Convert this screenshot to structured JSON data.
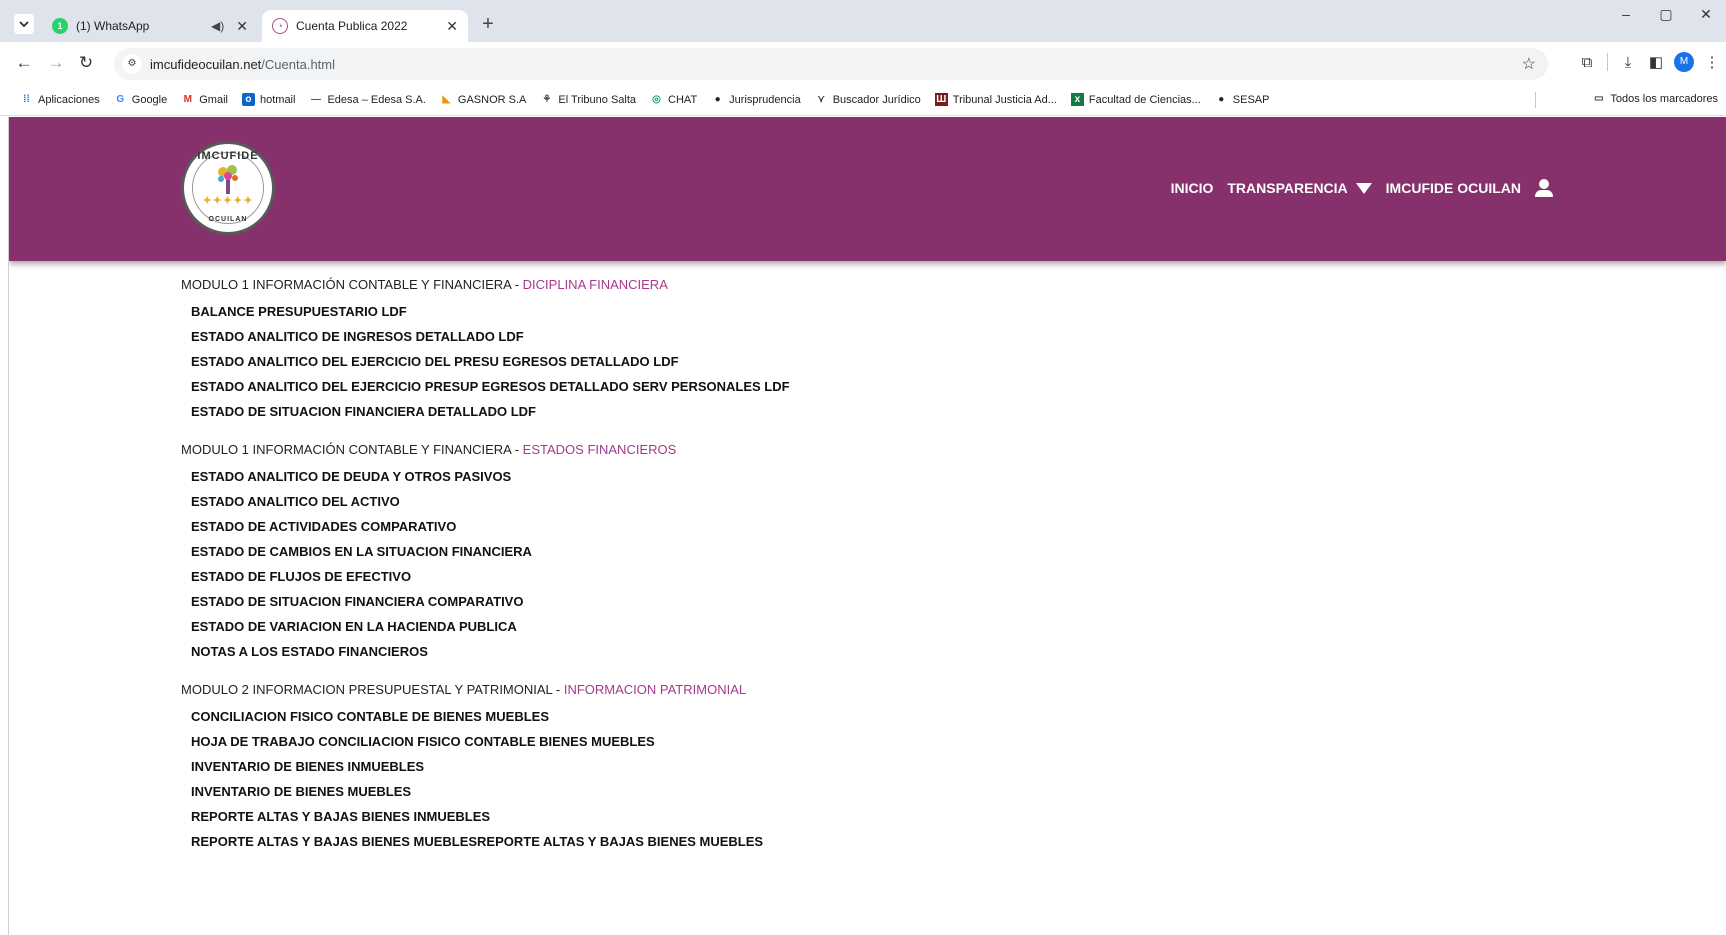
{
  "browser": {
    "tabs": [
      {
        "title": "(1) WhatsApp",
        "active": false,
        "icon": "whatsapp-icon",
        "badge": "1"
      },
      {
        "title": "Cuenta Publica 2022",
        "active": true,
        "icon": "site-favicon"
      }
    ],
    "url_domain": "imcufideocuilan.net",
    "url_path": "/Cuenta.html",
    "profile_initial": "M",
    "bookmarks": [
      {
        "label": "Aplicaciones",
        "icon": "apps-grid-icon",
        "color": "#1a73e8"
      },
      {
        "label": "Google",
        "icon": "google-icon",
        "color": "#4285f4"
      },
      {
        "label": "Gmail",
        "icon": "gmail-icon",
        "color": "#d93025"
      },
      {
        "label": "hotmail",
        "icon": "outlook-icon",
        "color": "#0a64c9"
      },
      {
        "label": "Edesa – Edesa S.A.",
        "icon": "edesa-icon",
        "color": "#555555"
      },
      {
        "label": "GASNOR S.A",
        "icon": "gasnor-icon",
        "color": "#f39200"
      },
      {
        "label": "El Tribuno Salta",
        "icon": "tribuno-icon",
        "color": "#444444"
      },
      {
        "label": "CHAT",
        "icon": "chat-icon",
        "color": "#10a37f"
      },
      {
        "label": "Jurisprudencia",
        "icon": "globe-icon",
        "color": "#222222"
      },
      {
        "label": "Buscador Jurídico",
        "icon": "buscador-icon",
        "color": "#444444"
      },
      {
        "label": "Tribunal Justicia Ad...",
        "icon": "tribunal-icon",
        "color": "#7a1b1b"
      },
      {
        "label": "Facultad de Ciencias...",
        "icon": "excel-icon",
        "color": "#107c41"
      },
      {
        "label": "SESAP",
        "icon": "globe-icon",
        "color": "#222222"
      }
    ],
    "all_bookmarks_label": "Todos los marcadores"
  },
  "site": {
    "brand_color": "#87316c",
    "accent_color": "#a7388c",
    "logo": {
      "top_text": "IMCUFIDE",
      "bottom_text": "OCUILAN"
    },
    "nav": {
      "inicio": "INICIO",
      "transparencia": "TRANSPARENCIA",
      "imcufide": "IMCUFIDE OCUILAN"
    }
  },
  "modules": [
    {
      "title": "MODULO 1 INFORMACIÓN CONTABLE Y FINANCIERA - ",
      "subtitle": "DICIPLINA FINANCIERA",
      "links": [
        "BALANCE PRESUPUESTARIO LDF",
        "ESTADO ANALITICO DE INGRESOS DETALLADO LDF",
        "ESTADO ANALITICO DEL EJERCICIO DEL PRESU EGRESOS DETALLADO LDF",
        "ESTADO ANALITICO DEL EJERCICIO PRESUP EGRESOS DETALLADO SERV PERSONALES LDF",
        "ESTADO DE SITUACION FINANCIERA DETALLADO LDF"
      ]
    },
    {
      "title": "MODULO 1 INFORMACIÓN CONTABLE Y FINANCIERA - ",
      "subtitle": "ESTADOS FINANCIEROS",
      "links": [
        "ESTADO ANALITICO DE DEUDA Y OTROS PASIVOS",
        "ESTADO ANALITICO DEL ACTIVO",
        "ESTADO DE ACTIVIDADES COMPARATIVO",
        "ESTADO DE CAMBIOS EN LA SITUACION FINANCIERA",
        "ESTADO DE FLUJOS DE EFECTIVO",
        "ESTADO DE SITUACION FINANCIERA COMPARATIVO",
        "ESTADO DE VARIACION EN LA HACIENDA PUBLICA",
        "NOTAS A LOS ESTADO FINANCIEROS"
      ]
    },
    {
      "title": "MODULO 2 INFORMACION PRESUPUESTAL Y PATRIMONIAL - ",
      "subtitle": "INFORMACION PATRIMONIAL",
      "links": [
        "CONCILIACION FISICO CONTABLE DE BIENES MUEBLES",
        "HOJA DE TRABAJO CONCILIACION FISICO CONTABLE BIENES MUEBLES",
        "INVENTARIO DE BIENES INMUEBLES",
        "INVENTARIO DE BIENES MUEBLES",
        "REPORTE ALTAS Y BAJAS BIENES INMUEBLES",
        "REPORTE ALTAS Y BAJAS BIENES MUEBLESREPORTE ALTAS Y BAJAS BIENES MUEBLES"
      ]
    }
  ]
}
